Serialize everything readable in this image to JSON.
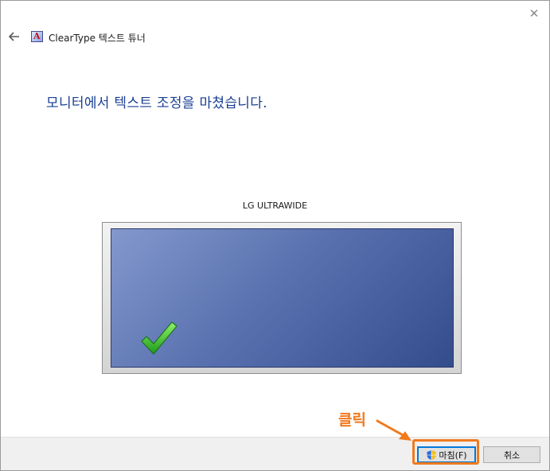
{
  "window": {
    "title": "ClearType 텍스트 튜너",
    "close_icon": "close-icon",
    "back_icon": "back-arrow-icon",
    "app_icon_letter": "A"
  },
  "main": {
    "heading": "모니터에서 텍스트 조정을 마쳤습니다.",
    "monitor_label": "LG ULTRAWIDE",
    "status_icon": "checkmark-icon",
    "accent_color": "#1a3f94"
  },
  "footer": {
    "finish_label": "마침(F)",
    "finish_icon": "uac-shield-icon",
    "cancel_label": "취소"
  },
  "annotation": {
    "text": "클릭",
    "color": "#f07a1e"
  }
}
